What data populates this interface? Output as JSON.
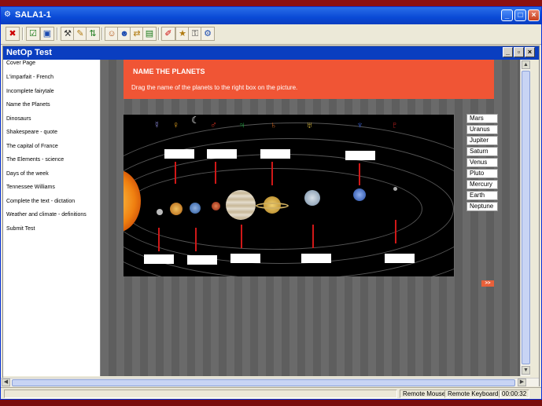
{
  "window": {
    "title": "SALA1-1",
    "controls": {
      "minimize": "_",
      "maximize": "□",
      "close": "×"
    }
  },
  "toolbar": {
    "buttons": [
      "close-session-icon",
      "check-icon",
      "screen-icon",
      "tools-icon",
      "pencil-icon",
      "arrows-icon",
      "users-icon",
      "users2-icon",
      "transfer-icon",
      "chart-icon",
      "marker-icon",
      "user-star-icon",
      "lock-icon",
      "gear-icon"
    ]
  },
  "inner_window": {
    "title": "NetOp Test",
    "controls": {
      "minimize": "_",
      "restore": "▫",
      "close": "×"
    }
  },
  "sidebar": {
    "items": [
      "Cover Page",
      "L'imparfait - French",
      "Incomplete fairytale",
      "Name the Planets",
      "Dinosaurs",
      "Shakespeare - quote",
      "The capital of France",
      "The Elements - science",
      "Days of the week",
      "Tennessee Williams",
      "Complete the text - dictation",
      "Weather and climate - definitions",
      "Submit Test"
    ]
  },
  "exercise": {
    "title": "NAME THE PLANETS",
    "instruction": "Drag the name of the planets to the right box on the picture.",
    "planet_names": [
      "Mars",
      "Uranus",
      "Jupiter",
      "Saturn",
      "Venus",
      "Pluto",
      "Mercury",
      "Earth",
      "Neptune"
    ],
    "next_label": ">>",
    "symbols": [
      "☿",
      "♀",
      "☾",
      "♂",
      "♃",
      "♄",
      "♅",
      "♆",
      "♇"
    ],
    "colors": {
      "header": "#f05535",
      "pointer": "#d01818"
    }
  },
  "statusbar": {
    "remote_mouse": "Remote Mouse",
    "remote_keyboard": "Remote Keyboard",
    "timer": "00:00:32"
  }
}
